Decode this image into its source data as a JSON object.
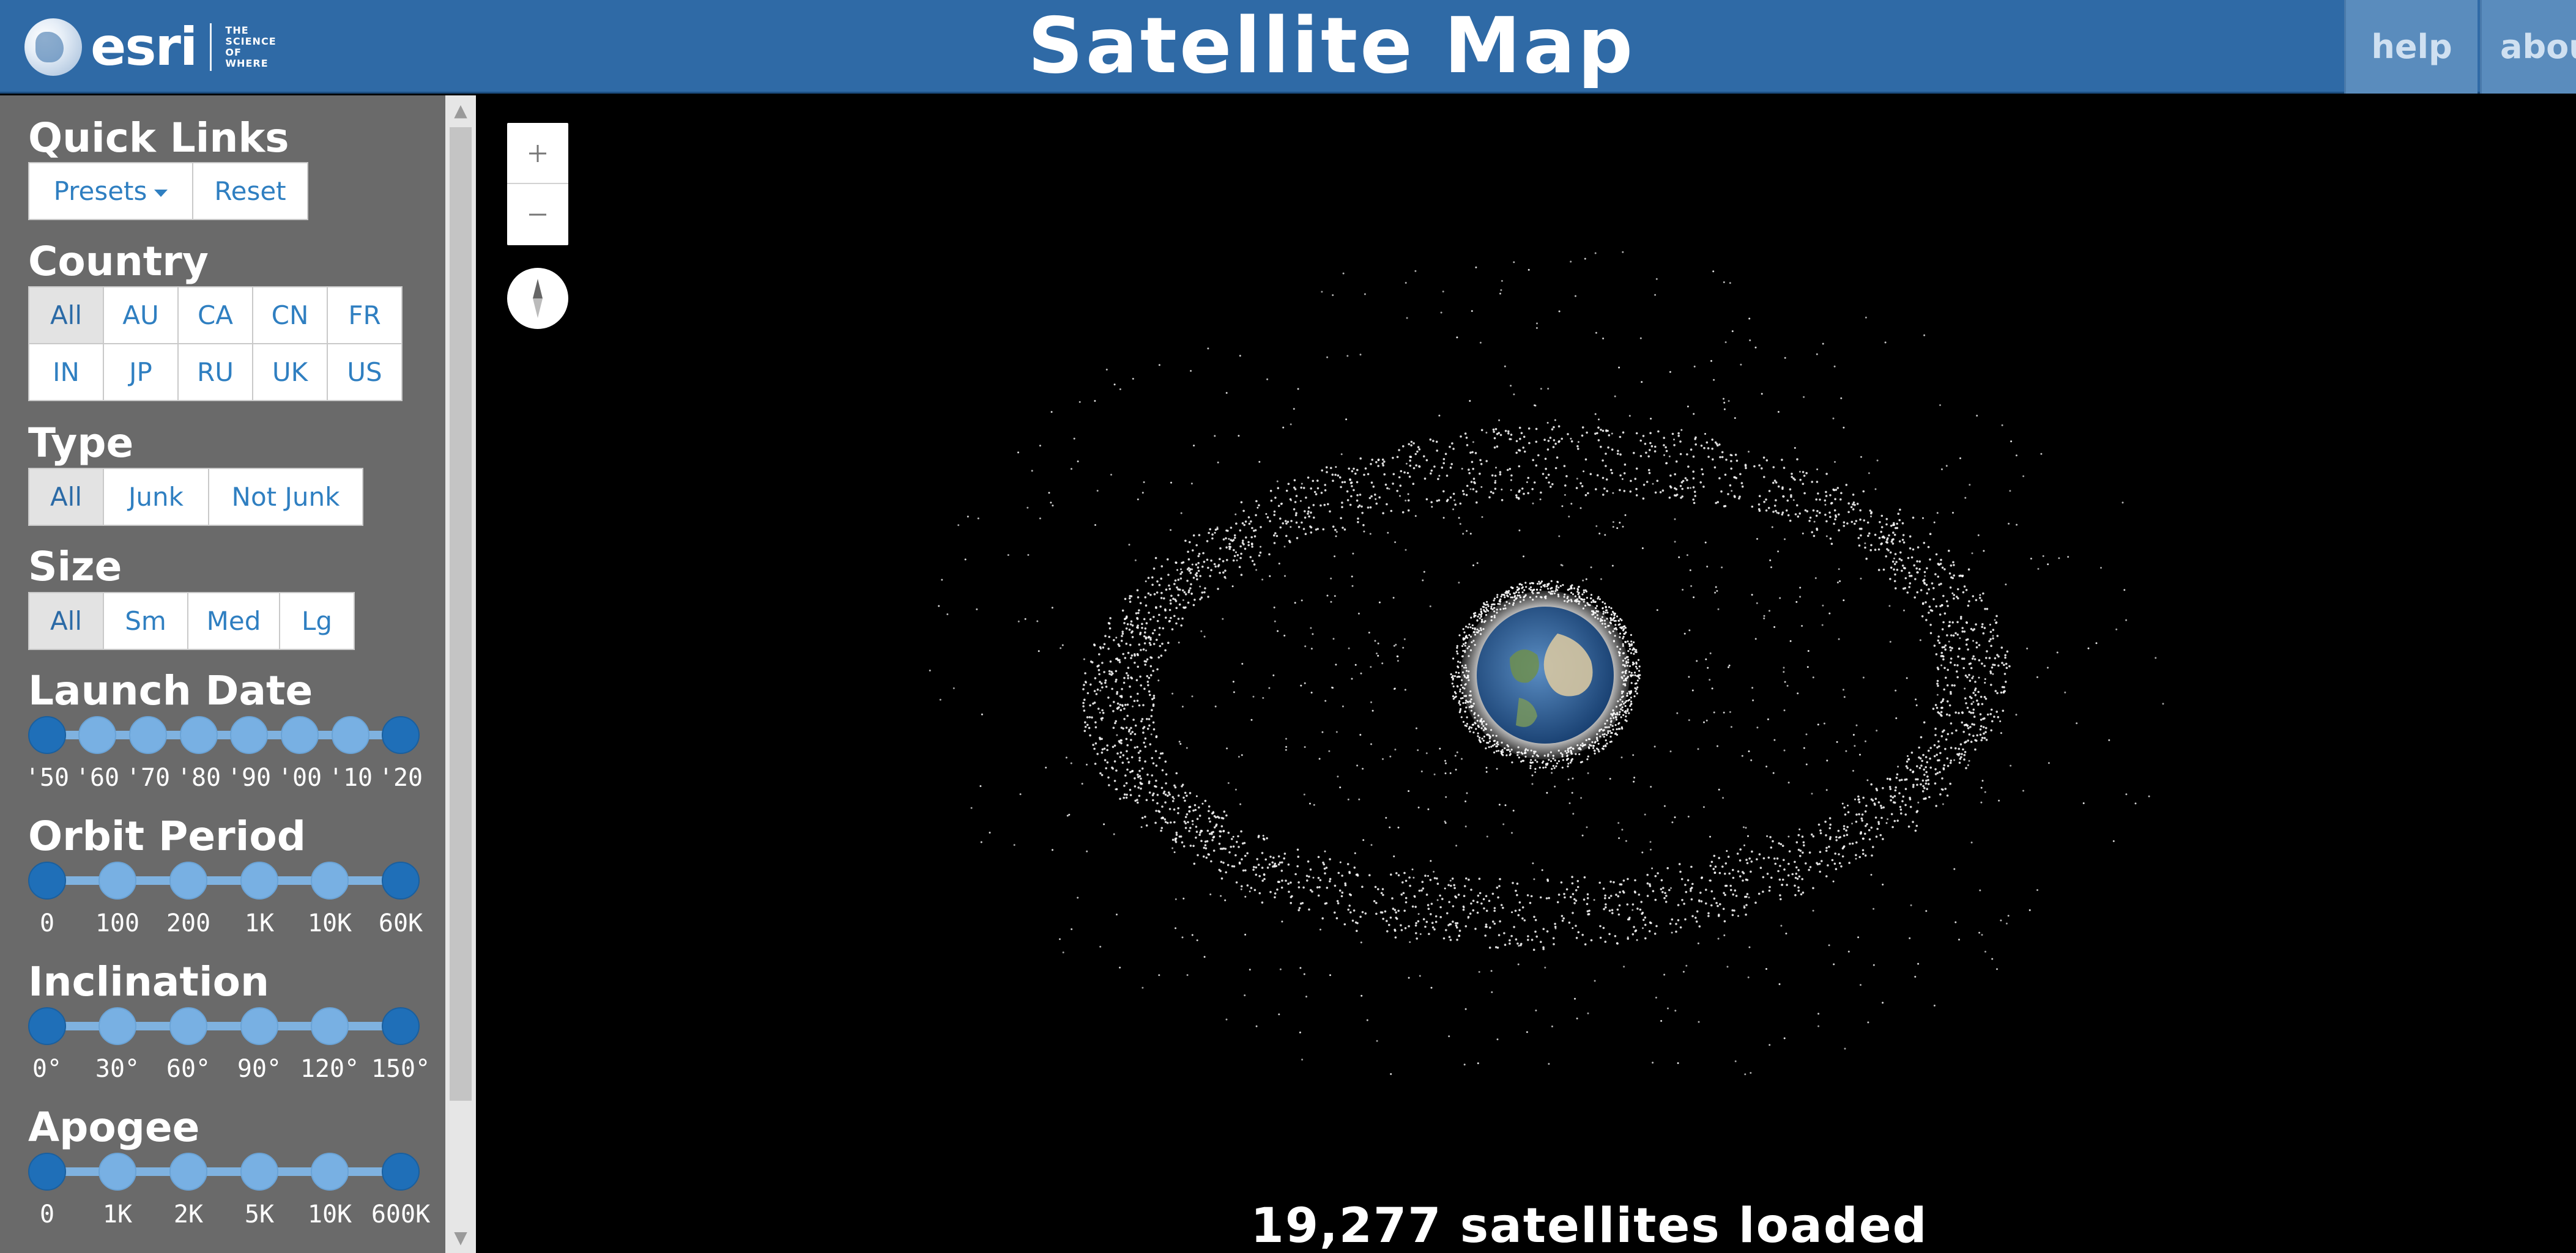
{
  "header": {
    "logo_text": "esri",
    "logo_tagline": [
      "THE",
      "SCIENCE",
      "OF",
      "WHERE"
    ],
    "title": "Satellite Map",
    "nav": {
      "help": "help",
      "about": "about"
    }
  },
  "sidebar": {
    "quick_links": {
      "title": "Quick Links",
      "presets_label": "Presets",
      "reset_label": "Reset"
    },
    "country": {
      "title": "Country",
      "selected": "All",
      "options": [
        "All",
        "AU",
        "CA",
        "CN",
        "FR",
        "IN",
        "JP",
        "RU",
        "UK",
        "US"
      ]
    },
    "type": {
      "title": "Type",
      "selected": "All",
      "options": [
        "All",
        "Junk",
        "Not Junk"
      ]
    },
    "size": {
      "title": "Size",
      "selected": "All",
      "options": [
        "All",
        "Sm",
        "Med",
        "Lg"
      ]
    },
    "launch_date": {
      "title": "Launch Date",
      "ticks": [
        "'50",
        "'60",
        "'70",
        "'80",
        "'90",
        "'00",
        "'10",
        "'20"
      ],
      "range": [
        "'50",
        "'20"
      ]
    },
    "orbit_period": {
      "title": "Orbit Period",
      "ticks": [
        "0",
        "100",
        "200",
        "1K",
        "10K",
        "60K"
      ],
      "range": [
        "0",
        "60K"
      ]
    },
    "inclination": {
      "title": "Inclination",
      "ticks": [
        "0°",
        "30°",
        "60°",
        "90°",
        "120°",
        "150°"
      ],
      "range": [
        "0°",
        "150°"
      ]
    },
    "apogee": {
      "title": "Apogee",
      "ticks": [
        "0",
        "1K",
        "2K",
        "5K",
        "10K",
        "600K"
      ],
      "range": [
        "0",
        "600K"
      ]
    }
  },
  "map": {
    "zoom_in_icon": "plus-icon",
    "zoom_out_icon": "minus-icon",
    "compass_icon": "compass-icon",
    "status": "19,277 satellites loaded"
  },
  "colors": {
    "header": "#2f6aa6",
    "sidebar": "#6a6a6a",
    "button_text": "#2f7fc1",
    "slider_knob": "#78b0e3",
    "slider_knob_end": "#1f6fb8"
  }
}
